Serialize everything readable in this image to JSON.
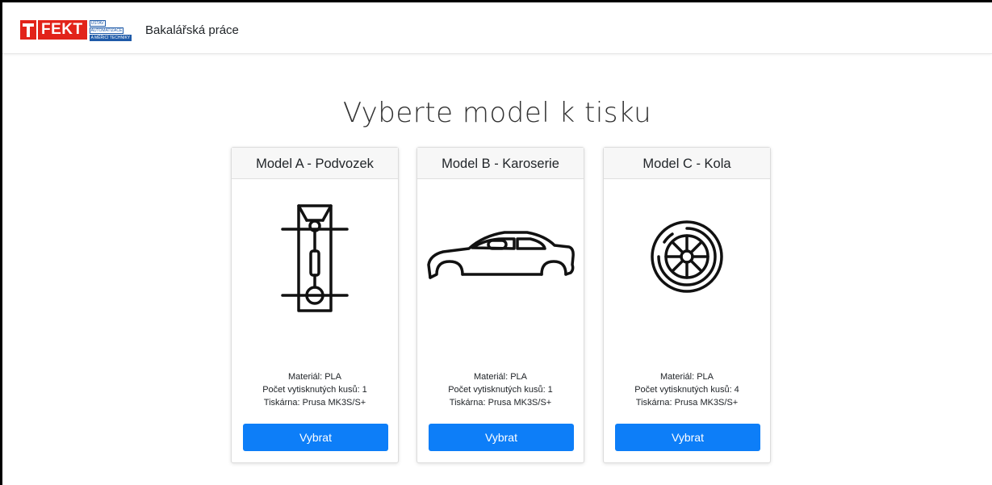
{
  "navbar": {
    "logo": {
      "brand": "FEKT",
      "lines": [
        "ÚSTAV",
        "AUTOMATIZACE",
        "A MĚŘICÍ TECHNIKY"
      ],
      "color_red": "#e2231a",
      "color_blue": "#1e5aa8"
    },
    "title": "Bakalářská práce"
  },
  "main": {
    "heading": "Vyberte model k tisku",
    "accent_color": "#0d7ef8",
    "cards": [
      {
        "title": "Model A - Podvozek",
        "icon": "chassis-icon",
        "material": "Materiál: PLA",
        "count": "Počet vytisknutých kusů: 1",
        "printer": "Tiskárna: Prusa MK3S/S+",
        "button": "Vybrat"
      },
      {
        "title": "Model B - Karoserie",
        "icon": "car-body-icon",
        "material": "Materiál: PLA",
        "count": "Počet vytisknutých kusů: 1",
        "printer": "Tiskárna: Prusa MK3S/S+",
        "button": "Vybrat"
      },
      {
        "title": "Model C - Kola",
        "icon": "wheel-icon",
        "material": "Materiál: PLA",
        "count": "Počet vytisknutých kusů: 4",
        "printer": "Tiskárna: Prusa MK3S/S+",
        "button": "Vybrat"
      }
    ]
  }
}
